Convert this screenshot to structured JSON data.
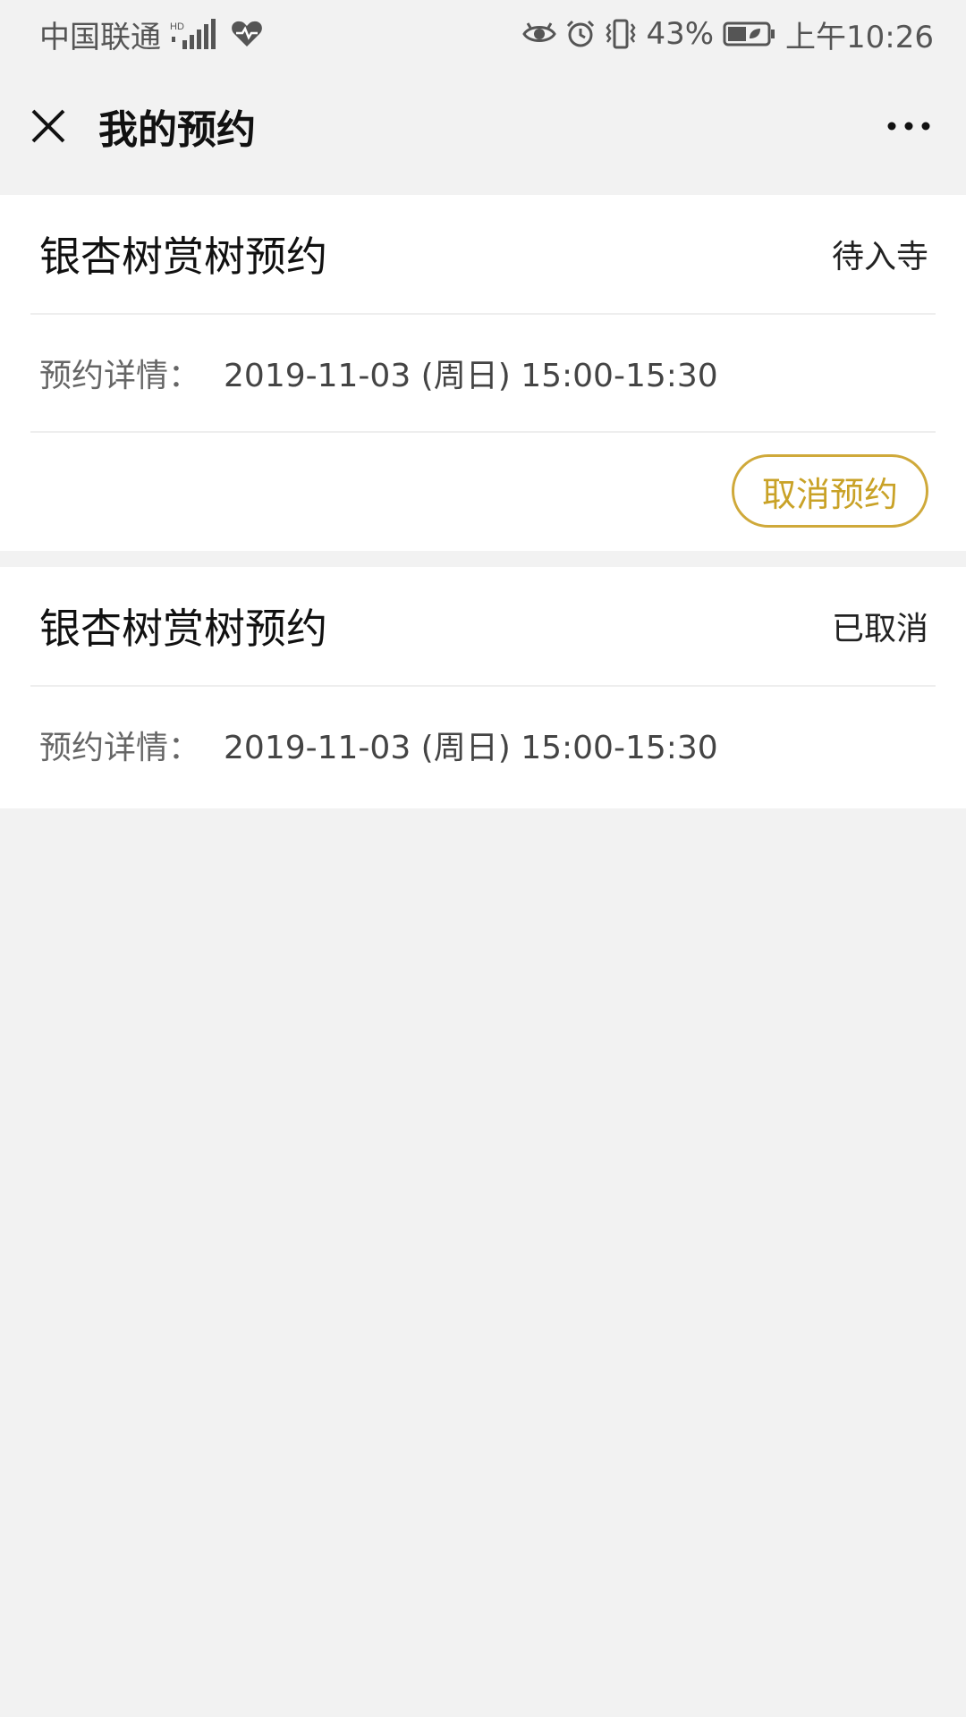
{
  "status_bar": {
    "carrier": "中国联通",
    "network_indicator": "HD",
    "battery_percent": "43%",
    "time": "上午10:26",
    "icons": [
      "signal-icon",
      "health-icon",
      "eye-icon",
      "alarm-icon",
      "vibrate-icon",
      "battery-icon"
    ]
  },
  "nav": {
    "title": "我的预约",
    "close_icon": "close-icon",
    "more_icon": "more-icon"
  },
  "reservations": [
    {
      "title": "银杏树赏树预约",
      "status": "待入寺",
      "detail_label": "预约详情：",
      "detail_value": "2019-11-03 (周日) 15:00-15:30",
      "action_label": "取消预约"
    },
    {
      "title": "银杏树赏树预约",
      "status": "已取消",
      "detail_label": "预约详情：",
      "detail_value": "2019-11-03 (周日) 15:00-15:30"
    }
  ],
  "colors": {
    "accent": "#c9a227",
    "background": "#f2f2f2",
    "card": "#ffffff"
  }
}
